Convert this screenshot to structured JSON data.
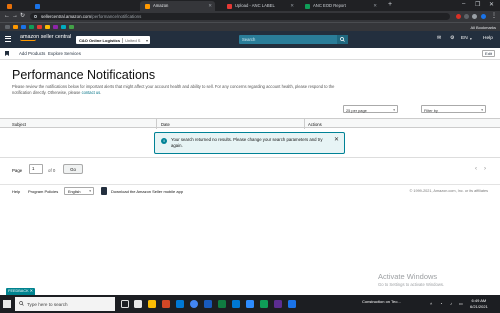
{
  "browser": {
    "tabs": [
      {
        "title": "",
        "active": false
      },
      {
        "title": "",
        "active": false
      },
      {
        "title": "Amazon",
        "active": true
      },
      {
        "title": "Upload - ANC LABEL",
        "active": false
      },
      {
        "title": "ANC EOD Report",
        "active": false
      }
    ],
    "url_domain": "sellercentral.amazon.com",
    "url_path": "/performance/notifications",
    "bookmarks_more": "All Bookmarks"
  },
  "header": {
    "logo_main": "amazon",
    "logo_sub": "seller central",
    "account_name": "C&O Online Logistics",
    "account_marketplace": "United S",
    "search_placeholder": "Search",
    "language": "EN",
    "help": "Help"
  },
  "subnav": {
    "items": [
      "Add Products",
      "Explore Services"
    ],
    "edit_label": "Edit"
  },
  "page": {
    "title": "Performance Notifications",
    "description_1": "Please review the notifications below for important alerts that might affect your account health and ability to sell. For any concerns regarding account health, please respond to the notification directly. Otherwise, please ",
    "description_link": "contact us",
    "description_2": "."
  },
  "filters": {
    "per_page": "25 per page",
    "filter_by": "Filter by"
  },
  "table": {
    "columns": [
      "Subject",
      "Date",
      "Actions"
    ]
  },
  "alert": {
    "message": "Your search returned no results. Please change your search parameters and try again."
  },
  "pagination": {
    "page_label": "Page",
    "current_page": "1",
    "of_label": "of 0",
    "go_label": "Go",
    "prev_arrow": "‹",
    "next_arrow": "›"
  },
  "footer": {
    "help": "Help",
    "program_policies": "Program Policies",
    "language": "English",
    "mobile_app": "Download the Amazon Seller mobile app",
    "copyright": "© 1999-2021, Amazon.com, Inc. or its affiliates"
  },
  "watermark": {
    "title": "Activate Windows",
    "subtitle": "Go to Settings to activate Windows."
  },
  "feedback_label": "FEEDBACK ✕",
  "taskbar": {
    "search_placeholder": "Type here to search",
    "weather": "Construction on Teo...",
    "time": "6:49 AM",
    "date": "6/21/2021"
  },
  "colors": {
    "header_bg": "#232f3e",
    "search_bg": "#2a7d99",
    "accent_teal": "#008296",
    "alert_bg": "#e7f4f5",
    "link": "#007185"
  }
}
